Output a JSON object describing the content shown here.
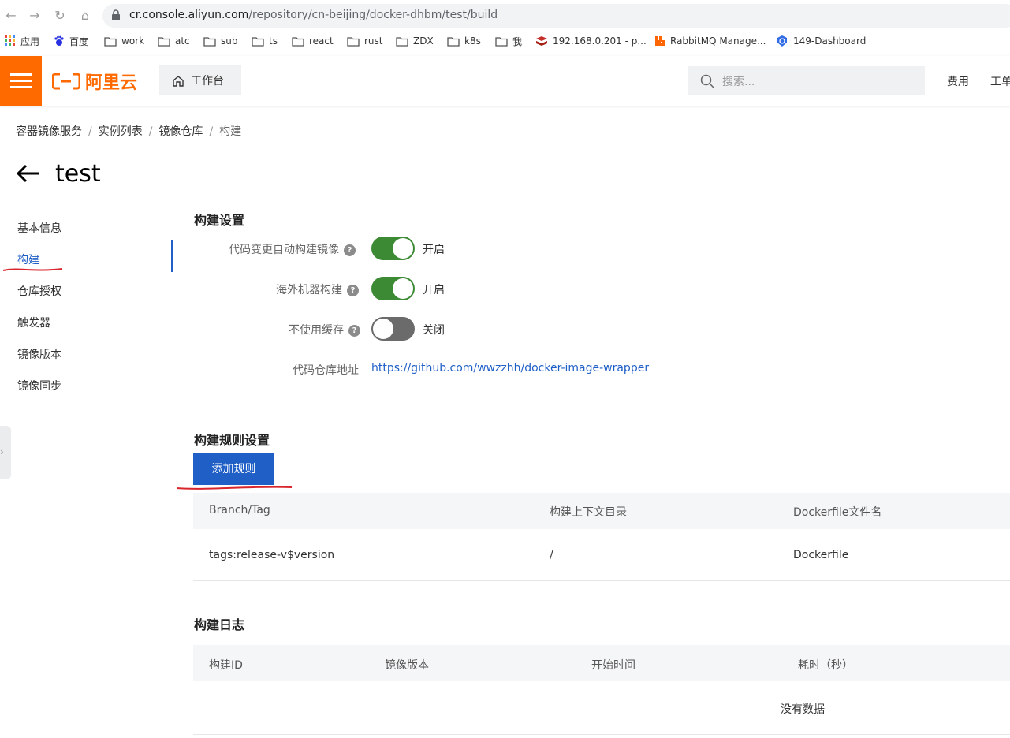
{
  "browser": {
    "url_host": "cr.console.aliyun.com",
    "url_path": "/repository/cn-beijing/docker-dhbm/test/build",
    "bookmarks": [
      "应用",
      "百度",
      "work",
      "atc",
      "sub",
      "ts",
      "react",
      "rust",
      "ZDX",
      "k8s",
      "我",
      "192.168.0.201 - p...",
      "RabbitMQ Manage...",
      "149-Dashboard"
    ]
  },
  "header": {
    "brand": "阿里云",
    "workbench": "工作台",
    "search_placeholder": "搜索...",
    "links": [
      "费用",
      "工单"
    ]
  },
  "breadcrumb": [
    "容器镜像服务",
    "实例列表",
    "镜像仓库",
    "构建"
  ],
  "page_title": "test",
  "sidebar": {
    "items": [
      {
        "label": "基本信息",
        "active": false
      },
      {
        "label": "构建",
        "active": true
      },
      {
        "label": "仓库授权",
        "active": false
      },
      {
        "label": "触发器",
        "active": false
      },
      {
        "label": "镜像版本",
        "active": false
      },
      {
        "label": "镜像同步",
        "active": false
      }
    ]
  },
  "build_settings": {
    "title": "构建设置",
    "auto_build": {
      "label": "代码变更自动构建镜像",
      "state": "开启",
      "on": true
    },
    "overseas_build": {
      "label": "海外机器构建",
      "state": "开启",
      "on": true
    },
    "no_cache": {
      "label": "不使用缓存",
      "state": "关闭",
      "on": false
    },
    "repo": {
      "label": "代码仓库地址",
      "url": "https://github.com/wwzzhh/docker-image-wrapper"
    }
  },
  "build_rules": {
    "title": "构建规则设置",
    "add_button": "添加规则",
    "columns": [
      "Branch/Tag",
      "构建上下文目录",
      "Dockerfile文件名"
    ],
    "rows": [
      {
        "branch_tag": "tags:release-v$version",
        "context_dir": "/",
        "dockerfile": "Dockerfile"
      }
    ]
  },
  "build_log": {
    "title": "构建日志",
    "columns": [
      "构建ID",
      "镜像版本",
      "开始时间",
      "耗时（秒）"
    ],
    "empty_text": "没有数据"
  },
  "colors": {
    "brand_orange": "#ff6a00",
    "primary_blue": "#1f5fc6",
    "toggle_on": "#3c8a34",
    "toggle_off": "#6b6b6b",
    "annotation_red": "#d9262c"
  }
}
